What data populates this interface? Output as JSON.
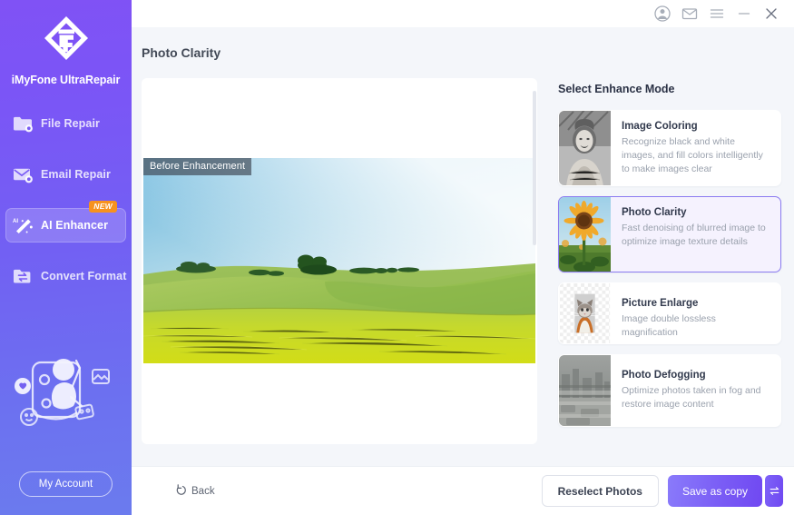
{
  "app": {
    "brand_name": "iMyFone UltraRepair",
    "logo_icon": "diamond-f-logo-icon"
  },
  "titlebar": {
    "buttons": [
      {
        "name": "account-icon",
        "glyph": "person"
      },
      {
        "name": "mail-icon",
        "glyph": "envelope"
      },
      {
        "name": "menu-icon",
        "glyph": "hamburger"
      },
      {
        "name": "minimize-icon",
        "glyph": "minus"
      },
      {
        "name": "close-icon",
        "glyph": "cross"
      }
    ]
  },
  "sidebar": {
    "items": [
      {
        "label": "File Repair",
        "icon": "folder-repair-icon",
        "active": false,
        "badge": ""
      },
      {
        "label": "Email Repair",
        "icon": "email-repair-icon",
        "active": false,
        "badge": ""
      },
      {
        "label": "AI Enhancer",
        "icon": "magic-wand-ai-icon",
        "active": true,
        "badge": "NEW"
      },
      {
        "label": "Convert Format",
        "icon": "convert-format-icon",
        "active": false,
        "badge": ""
      }
    ],
    "illustration": "person-photo-album-illustration",
    "account_button": "My Account"
  },
  "page": {
    "title": "Photo Clarity"
  },
  "preview": {
    "badge_label": "Before Enhancement",
    "image_alt": "green-rolling-hills-landscape"
  },
  "enhance": {
    "title": "Select Enhance Mode",
    "modes": [
      {
        "name": "Image Coloring",
        "desc": "Recognize black and white images, and fill colors intelligently to make images clear",
        "thumb": "bw-portrait-thumb",
        "selected": false
      },
      {
        "name": "Photo Clarity",
        "desc": "Fast denoising of blurred image to optimize image texture details",
        "thumb": "sunflower-thumb",
        "selected": true
      },
      {
        "name": "Picture Enlarge",
        "desc": "Image double lossless magnification",
        "thumb": "cat-thumb",
        "selected": false
      },
      {
        "name": "Photo Defogging",
        "desc": "Optimize photos taken in fog and restore image content",
        "thumb": "foggy-city-thumb",
        "selected": false
      }
    ]
  },
  "footer": {
    "back_label": "Back",
    "back_icon": "undo-arrow-icon",
    "reselect_label": "Reselect Photos",
    "save_label": "Save as copy",
    "save_more_icon": "swap-arrows-icon"
  },
  "colors": {
    "sidebar_top": "#8052f5",
    "sidebar_bottom": "#6b7bee",
    "accent": "#7a5df5",
    "selected_card_border": "#8b7bf0",
    "selected_card_bg": "#f5f2fe",
    "new_badge": "#f7921e",
    "page_bg": "#f4f6fa"
  }
}
